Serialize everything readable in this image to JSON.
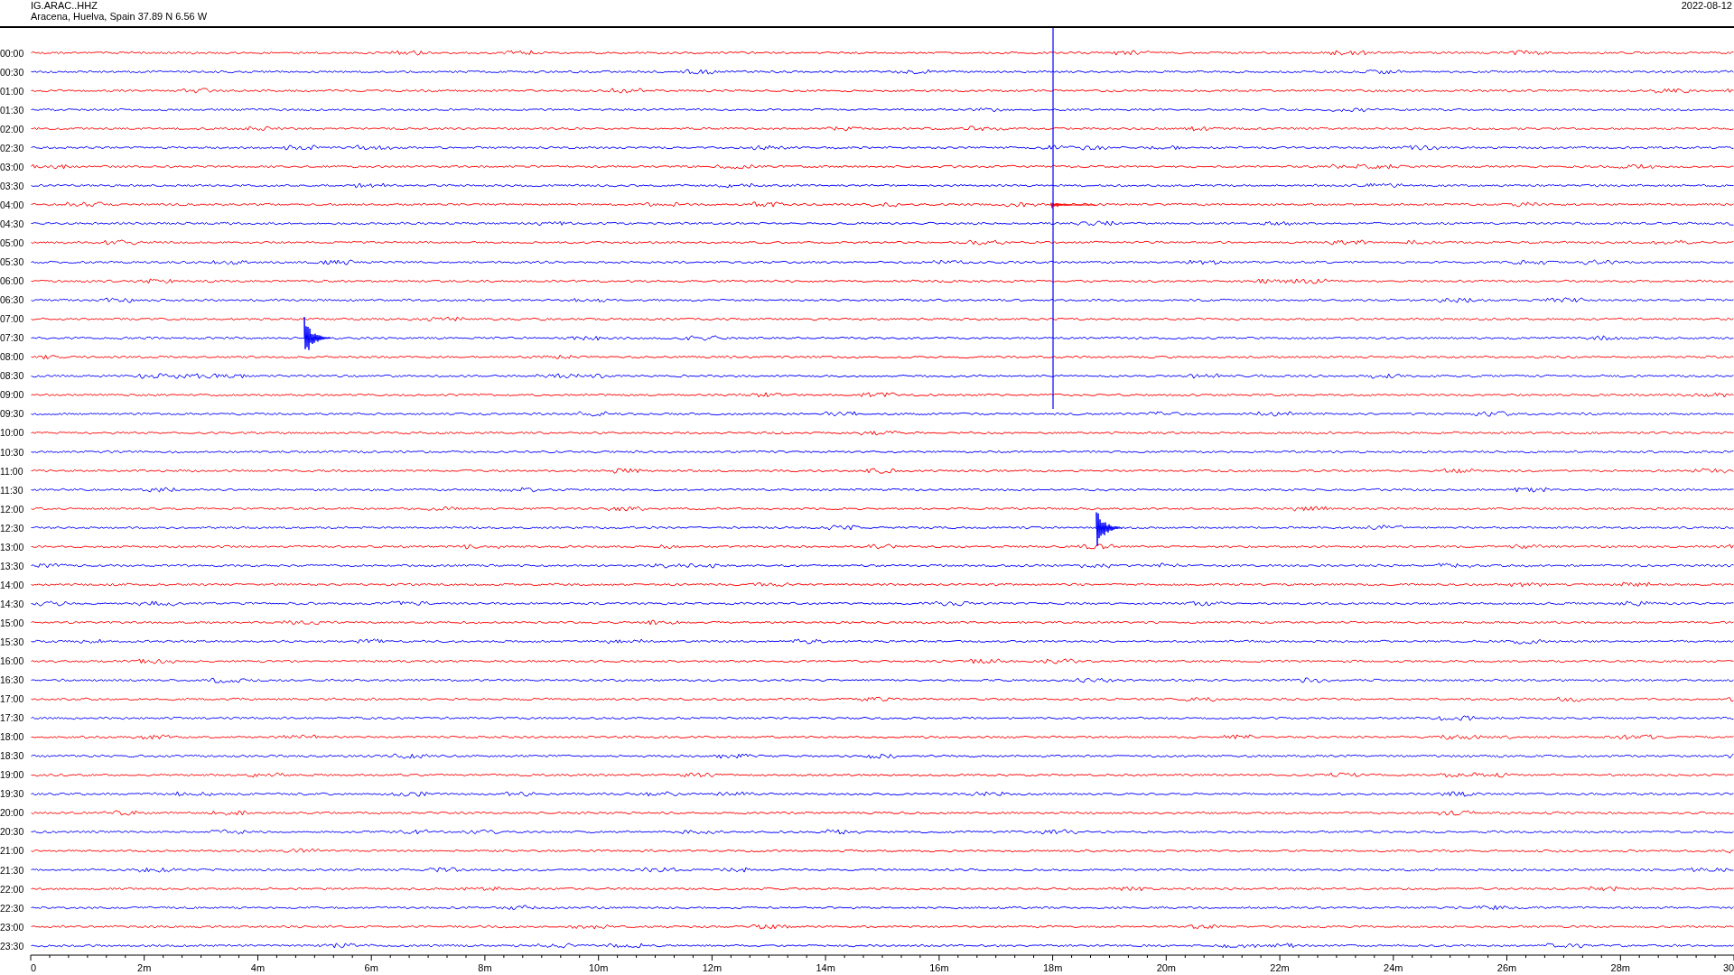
{
  "header": {
    "station": "IG.ARAC..HHZ",
    "location": "Aracena, Huelva, Spain  37.89 N 6.56 W",
    "date": "2022-08-12"
  },
  "traces": [
    {
      "time": "00:00",
      "color": "#ff0000"
    },
    {
      "time": "00:30",
      "color": "#0000ff"
    },
    {
      "time": "01:00",
      "color": "#ff0000"
    },
    {
      "time": "01:30",
      "color": "#0000ff"
    },
    {
      "time": "02:00",
      "color": "#ff0000"
    },
    {
      "time": "02:30",
      "color": "#0000ff"
    },
    {
      "time": "03:00",
      "color": "#ff0000"
    },
    {
      "time": "03:30",
      "color": "#0000ff"
    },
    {
      "time": "04:00",
      "color": "#ff0000"
    },
    {
      "time": "04:30",
      "color": "#0000ff"
    },
    {
      "time": "05:00",
      "color": "#ff0000"
    },
    {
      "time": "05:30",
      "color": "#0000ff"
    },
    {
      "time": "06:00",
      "color": "#ff0000"
    },
    {
      "time": "06:30",
      "color": "#0000ff"
    },
    {
      "time": "07:00",
      "color": "#ff0000"
    },
    {
      "time": "07:30",
      "color": "#0000ff"
    },
    {
      "time": "08:00",
      "color": "#ff0000"
    },
    {
      "time": "08:30",
      "color": "#0000ff"
    },
    {
      "time": "09:00",
      "color": "#ff0000"
    },
    {
      "time": "09:30",
      "color": "#0000ff"
    },
    {
      "time": "10:00",
      "color": "#ff0000"
    },
    {
      "time": "10:30",
      "color": "#0000ff"
    },
    {
      "time": "11:00",
      "color": "#ff0000"
    },
    {
      "time": "11:30",
      "color": "#0000ff"
    },
    {
      "time": "12:00",
      "color": "#ff0000"
    },
    {
      "time": "12:30",
      "color": "#0000ff"
    },
    {
      "time": "13:00",
      "color": "#ff0000"
    },
    {
      "time": "13:30",
      "color": "#0000ff"
    },
    {
      "time": "14:00",
      "color": "#ff0000"
    },
    {
      "time": "14:30",
      "color": "#0000ff"
    },
    {
      "time": "15:00",
      "color": "#ff0000"
    },
    {
      "time": "15:30",
      "color": "#0000ff"
    },
    {
      "time": "16:00",
      "color": "#ff0000"
    },
    {
      "time": "16:30",
      "color": "#0000ff"
    },
    {
      "time": "17:00",
      "color": "#ff0000"
    },
    {
      "time": "17:30",
      "color": "#0000ff"
    },
    {
      "time": "18:00",
      "color": "#ff0000"
    },
    {
      "time": "18:30",
      "color": "#0000ff"
    },
    {
      "time": "19:00",
      "color": "#ff0000"
    },
    {
      "time": "19:30",
      "color": "#0000ff"
    },
    {
      "time": "20:00",
      "color": "#ff0000"
    },
    {
      "time": "20:30",
      "color": "#0000ff"
    },
    {
      "time": "21:00",
      "color": "#ff0000"
    },
    {
      "time": "21:30",
      "color": "#0000ff"
    },
    {
      "time": "22:00",
      "color": "#ff0000"
    },
    {
      "time": "22:30",
      "color": "#0000ff"
    },
    {
      "time": "23:00",
      "color": "#ff0000"
    },
    {
      "time": "23:30",
      "color": "#0000ff"
    }
  ],
  "x_axis": {
    "labels": [
      "0",
      "2m",
      "4m",
      "6m",
      "8m",
      "10m",
      "12m",
      "14m",
      "16m",
      "18m",
      "20m",
      "22m",
      "24m",
      "26m",
      "28m",
      "30"
    ]
  }
}
